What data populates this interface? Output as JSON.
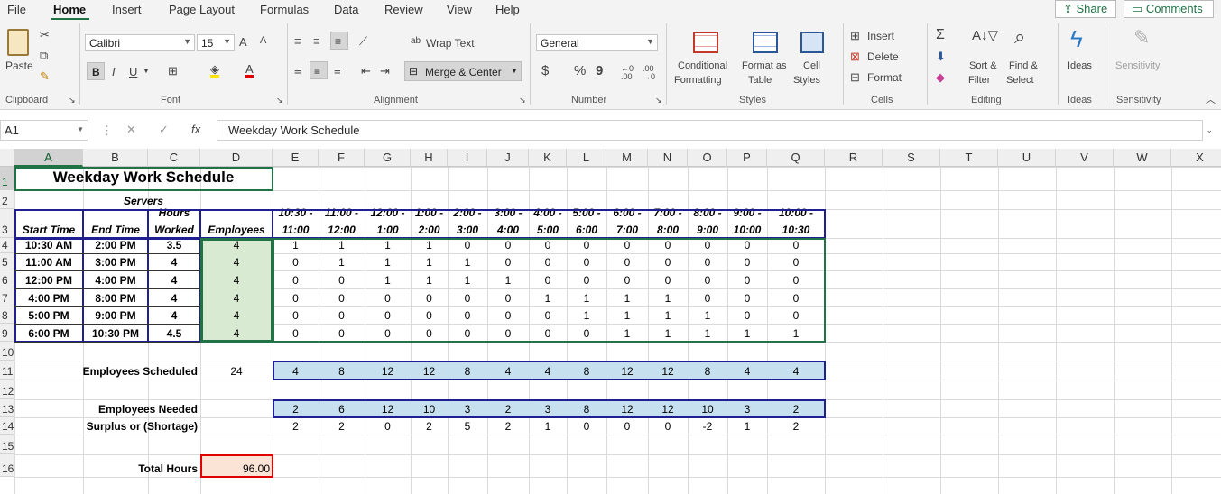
{
  "menu": {
    "tabs": [
      "File",
      "Home",
      "Insert",
      "Page Layout",
      "Formulas",
      "Data",
      "Review",
      "View",
      "Help"
    ],
    "share_label": "Share",
    "comments_label": "Comments"
  },
  "ribbon": {
    "clipboard": {
      "paste_label": "Paste",
      "group_label": "Clipboard"
    },
    "font": {
      "font_name": "Calibri",
      "font_size": "15",
      "bold": "B",
      "italic": "I",
      "underline": "U",
      "grow": "A",
      "shrink": "A",
      "font_color": "A",
      "group_label": "Font"
    },
    "alignment": {
      "wrap_text": "Wrap Text",
      "merge_center": "Merge & Center",
      "group_label": "Alignment"
    },
    "number": {
      "format": "General",
      "currency": "$",
      "percent": "%",
      "comma": "9",
      "group_label": "Number"
    },
    "styles": {
      "conditional_1": "Conditional",
      "conditional_2": "Formatting",
      "format_table_1": "Format as",
      "format_table_2": "Table",
      "cell_styles_1": "Cell",
      "cell_styles_2": "Styles",
      "group_label": "Styles"
    },
    "cells": {
      "insert": "Insert",
      "delete": "Delete",
      "format": "Format",
      "group_label": "Cells"
    },
    "editing": {
      "sort_1": "Sort &",
      "sort_2": "Filter",
      "find_1": "Find &",
      "find_2": "Select",
      "group_label": "Editing"
    },
    "ideas": {
      "label": "Ideas",
      "group_label": "Ideas"
    },
    "sensitivity": {
      "label": "Sensitivity",
      "group_label": "Sensitivity"
    }
  },
  "formula_bar": {
    "name_box": "A1",
    "fx": "fx",
    "content": "Weekday Work Schedule"
  },
  "grid": {
    "columns": [
      "A",
      "B",
      "C",
      "D",
      "E",
      "F",
      "G",
      "H",
      "I",
      "J",
      "K",
      "L",
      "M",
      "N",
      "O",
      "P",
      "Q",
      "R",
      "S",
      "T",
      "U",
      "V",
      "W",
      "X"
    ],
    "rows": [
      "1",
      "2",
      "3",
      "4",
      "5",
      "6",
      "7",
      "8",
      "9",
      "10",
      "11",
      "12",
      "13",
      "14",
      "15",
      "16"
    ],
    "title": "Weekday Work Schedule",
    "subtitle": "Servers",
    "headers": {
      "start": "Start Time",
      "end": "End Time",
      "hours_1": "Hours",
      "hours_2": "Worked",
      "employees": "Employees"
    },
    "slots": [
      [
        "10:30 -",
        "11:00"
      ],
      [
        "11:00 -",
        "12:00"
      ],
      [
        "12:00 -",
        "1:00"
      ],
      [
        "1:00 -",
        "2:00"
      ],
      [
        "2:00 -",
        "3:00"
      ],
      [
        "3:00 -",
        "4:00"
      ],
      [
        "4:00 -",
        "5:00"
      ],
      [
        "5:00 -",
        "6:00"
      ],
      [
        "6:00 -",
        "7:00"
      ],
      [
        "7:00 -",
        "8:00"
      ],
      [
        "8:00 -",
        "9:00"
      ],
      [
        "9:00 -",
        "10:00"
      ],
      [
        "10:00 -",
        "10:30"
      ]
    ],
    "shifts": [
      {
        "start": "10:30 AM",
        "end": "2:00 PM",
        "hours": "3.5",
        "emp": "4",
        "slots": [
          "1",
          "1",
          "1",
          "1",
          "0",
          "0",
          "0",
          "0",
          "0",
          "0",
          "0",
          "0",
          "0"
        ]
      },
      {
        "start": "11:00 AM",
        "end": "3:00 PM",
        "hours": "4",
        "emp": "4",
        "slots": [
          "0",
          "1",
          "1",
          "1",
          "1",
          "0",
          "0",
          "0",
          "0",
          "0",
          "0",
          "0",
          "0"
        ]
      },
      {
        "start": "12:00 PM",
        "end": "4:00 PM",
        "hours": "4",
        "emp": "4",
        "slots": [
          "0",
          "0",
          "1",
          "1",
          "1",
          "1",
          "0",
          "0",
          "0",
          "0",
          "0",
          "0",
          "0"
        ]
      },
      {
        "start": "4:00 PM",
        "end": "8:00 PM",
        "hours": "4",
        "emp": "4",
        "slots": [
          "0",
          "0",
          "0",
          "0",
          "0",
          "0",
          "1",
          "1",
          "1",
          "1",
          "0",
          "0",
          "0"
        ]
      },
      {
        "start": "5:00 PM",
        "end": "9:00 PM",
        "hours": "4",
        "emp": "4",
        "slots": [
          "0",
          "0",
          "0",
          "0",
          "0",
          "0",
          "0",
          "1",
          "1",
          "1",
          "1",
          "0",
          "0"
        ]
      },
      {
        "start": "6:00 PM",
        "end": "10:30 PM",
        "hours": "4.5",
        "emp": "4",
        "slots": [
          "0",
          "0",
          "0",
          "0",
          "0",
          "0",
          "0",
          "0",
          "1",
          "1",
          "1",
          "1",
          "1"
        ]
      }
    ],
    "scheduled": {
      "label": "Employees Scheduled",
      "total": "24",
      "values": [
        "4",
        "8",
        "12",
        "12",
        "8",
        "4",
        "4",
        "8",
        "12",
        "12",
        "8",
        "4",
        "4"
      ]
    },
    "needed": {
      "label": "Employees Needed",
      "values": [
        "2",
        "6",
        "12",
        "10",
        "3",
        "2",
        "3",
        "8",
        "12",
        "12",
        "10",
        "3",
        "2"
      ]
    },
    "surplus": {
      "label": "Surplus or (Shortage)",
      "values": [
        "2",
        "2",
        "0",
        "2",
        "5",
        "2",
        "1",
        "0",
        "0",
        "0",
        "-2",
        "1",
        "2"
      ]
    },
    "total_hours": {
      "label": "Total Hours",
      "value": "96.00"
    }
  },
  "colors": {
    "accent": "#217346",
    "green_fill": "#d9ead3",
    "blue_fill": "#c7e0f0",
    "red_border": "#e00000",
    "peach_fill": "#fbe3d6",
    "navy_border": "#1f1f8f"
  }
}
